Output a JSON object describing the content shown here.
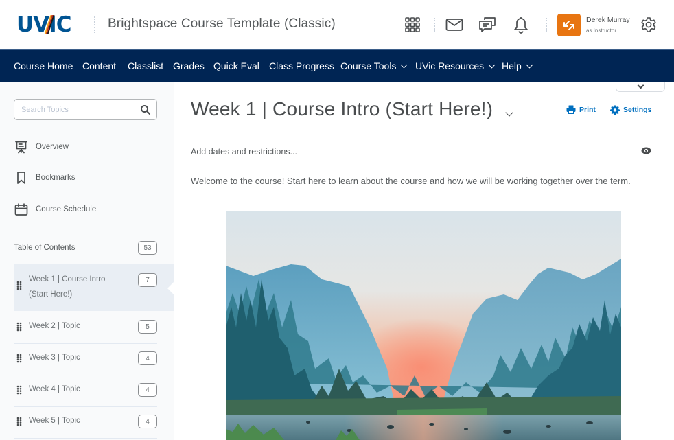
{
  "header": {
    "logo_text": "UVIC",
    "course_title": "Brightspace Course Template (Classic)",
    "icons": [
      "waffle-icon",
      "mail-icon",
      "chat-icon",
      "bell-icon"
    ],
    "user": {
      "name": "Derek Murray",
      "role": "as Instructor",
      "avatar_color": "#e87511"
    },
    "settings_icon": "gear-icon"
  },
  "navbar": {
    "background": "#002554",
    "items": [
      {
        "label": "Course Home",
        "dropdown": false
      },
      {
        "label": "Content",
        "dropdown": false
      },
      {
        "label": "Classlist",
        "dropdown": false
      },
      {
        "label": "Grades",
        "dropdown": false
      },
      {
        "label": "Quick Eval",
        "dropdown": false
      },
      {
        "label": "Class Progress",
        "dropdown": false
      },
      {
        "label": "Course Tools",
        "dropdown": true
      },
      {
        "label": "UVic Resources",
        "dropdown": true
      },
      {
        "label": "Help",
        "dropdown": true
      }
    ]
  },
  "sidebar": {
    "search": {
      "placeholder": "Search Topics",
      "value": ""
    },
    "links": [
      {
        "label": "Overview",
        "icon": "presentation-icon"
      },
      {
        "label": "Bookmarks",
        "icon": "bookmark-icon"
      },
      {
        "label": "Course Schedule",
        "icon": "calendar-icon"
      }
    ],
    "toc": {
      "label": "Table of Contents",
      "count": "53"
    },
    "modules": [
      {
        "label_line1": "Week 1 | Course Intro",
        "label_line2": "(Start Here!)",
        "count": "7",
        "active": true
      },
      {
        "label_line1": "Week 2 | Topic",
        "count": "5",
        "active": false
      },
      {
        "label_line1": "Week 3 | Topic",
        "count": "4",
        "active": false
      },
      {
        "label_line1": "Week 4 | Topic",
        "count": "4",
        "active": false
      },
      {
        "label_line1": "Week 5 | Topic",
        "count": "4",
        "active": false
      }
    ]
  },
  "main": {
    "title": "Week 1 | Course Intro (Start Here!)",
    "actions": {
      "print": "Print",
      "settings": "Settings"
    },
    "accent": "#006fbf",
    "add_dates": "Add dates and restrictions...",
    "welcome": "Welcome to the course! Start here to learn about the course and how we will be working together over the term.",
    "hero_image": "mountain-valley-sunrise-photo"
  }
}
